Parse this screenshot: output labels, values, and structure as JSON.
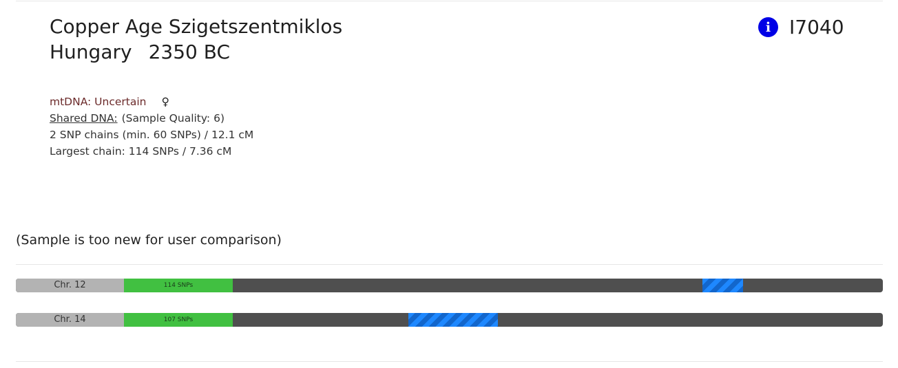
{
  "header": {
    "title_line1": "Copper Age Szigetszentmiklos",
    "country": "Hungary",
    "date": "2350 BC",
    "sample_id": "I7040",
    "info_icon": "info-icon",
    "info_glyph": "i"
  },
  "details": {
    "mtdna": "mtDNA: Uncertain",
    "sex_symbol": "♀",
    "shared_label": "Shared DNA:",
    "quality": "(Sample Quality: 6)",
    "chains": "2 SNP chains (min. 60 SNPs) / 12.1 cM",
    "largest": "Largest chain: 114 SNPs / 7.36 cM"
  },
  "note": "(Sample is too new for user comparison)",
  "chromosomes": [
    {
      "label": "Chr. 12",
      "snps": "114 SNPs"
    },
    {
      "label": "Chr. 14",
      "snps": "107 SNPs"
    }
  ],
  "colors": {
    "info_icon": "#0000e6",
    "chromosome_bar": "#4f4f4f",
    "label_bg": "#b3b3b3",
    "snp_green": "#41c041",
    "segment_blue": "#1e88ff",
    "mtdna_text": "#6b2a2a"
  }
}
